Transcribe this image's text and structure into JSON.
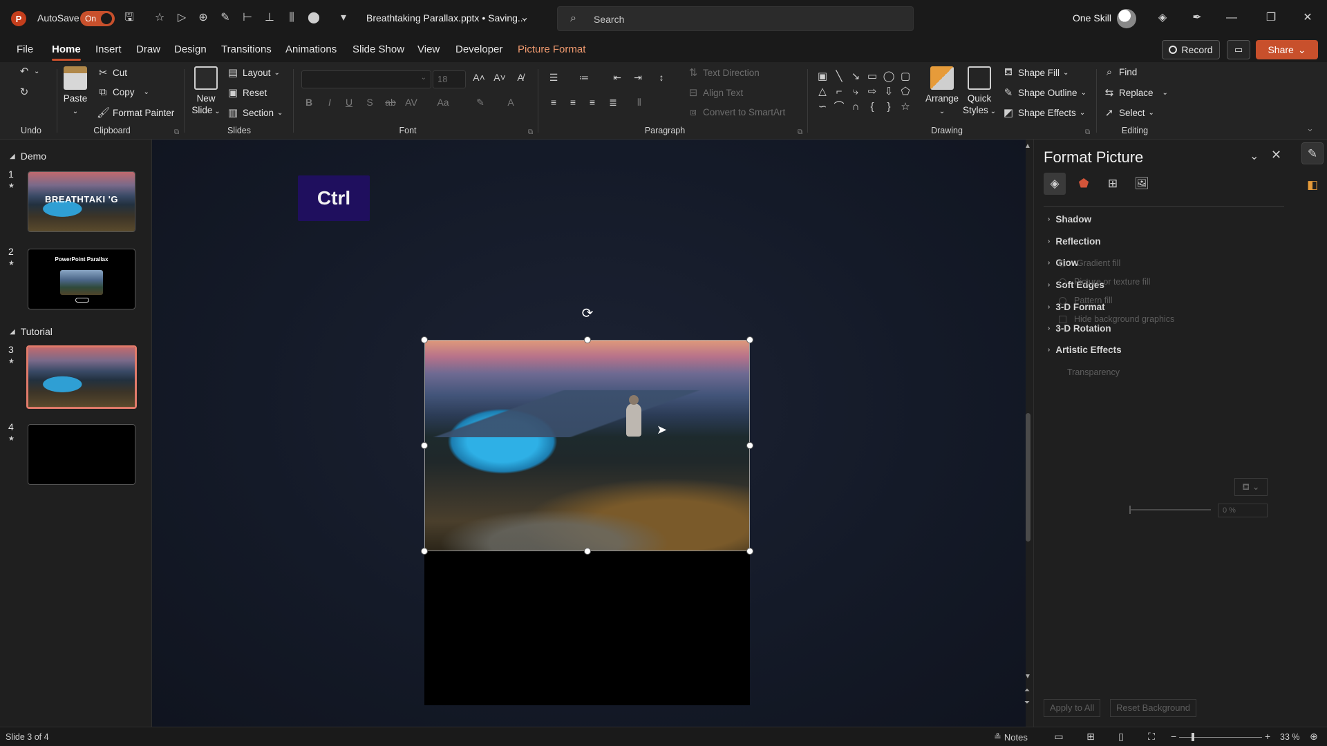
{
  "titlebar": {
    "autosave_label": "AutoSave",
    "autosave_state": "On",
    "doc_title": "Breathtaking Parallax.pptx • Saving...",
    "search_placeholder": "Search",
    "user_name": "One Skill"
  },
  "tabs": [
    "File",
    "Home",
    "Insert",
    "Draw",
    "Design",
    "Transitions",
    "Animations",
    "Slide Show",
    "View",
    "Developer",
    "Picture Format"
  ],
  "active_tab": "Home",
  "actions": {
    "record": "Record",
    "share": "Share"
  },
  "ribbon": {
    "undo_group": "Undo",
    "clipboard": {
      "paste": "Paste",
      "cut": "Cut",
      "copy": "Copy",
      "format_painter": "Format Painter",
      "label": "Clipboard"
    },
    "slides": {
      "new_slide": "New Slide",
      "layout": "Layout",
      "reset": "Reset",
      "section": "Section",
      "label": "Slides"
    },
    "font": {
      "size": "18",
      "label": "Font"
    },
    "paragraph": {
      "text_direction": "Text Direction",
      "align_text": "Align Text",
      "convert_smartart": "Convert to SmartArt",
      "label": "Paragraph"
    },
    "drawing": {
      "arrange": "Arrange",
      "quick_styles": "Quick Styles",
      "shape_fill": "Shape Fill",
      "shape_outline": "Shape Outline",
      "shape_effects": "Shape Effects",
      "label": "Drawing"
    },
    "editing": {
      "find": "Find",
      "replace": "Replace",
      "select": "Select",
      "label": "Editing"
    }
  },
  "thumbnails": {
    "sections": [
      "Demo",
      "Tutorial"
    ],
    "slides": [
      {
        "num": "1",
        "title": "BREATHTAKI  'G"
      },
      {
        "num": "2",
        "title": "PowerPoint Parallax"
      },
      {
        "num": "3",
        "title": ""
      },
      {
        "num": "4",
        "title": ""
      }
    ]
  },
  "canvas": {
    "key_overlay": "Ctrl"
  },
  "pane": {
    "title": "Format Picture",
    "sections": [
      "Shadow",
      "Reflection",
      "Glow",
      "Soft Edges",
      "3-D Format",
      "3-D Rotation",
      "Artistic Effects"
    ],
    "ghost_items": [
      "Gradient fill",
      "Picture or texture fill",
      "Pattern fill",
      "Hide background graphics",
      "Transparency",
      "0 %"
    ],
    "apply_all": "Apply to All",
    "reset_background": "Reset Background"
  },
  "status": {
    "slide_info": "Slide 3 of 4",
    "notes": "Notes",
    "zoom": "33 %"
  },
  "colors": {
    "accent": "#c8502c",
    "selected_thumb": "#e07a6a",
    "ctrl_key_bg": "#1f0f5e"
  }
}
